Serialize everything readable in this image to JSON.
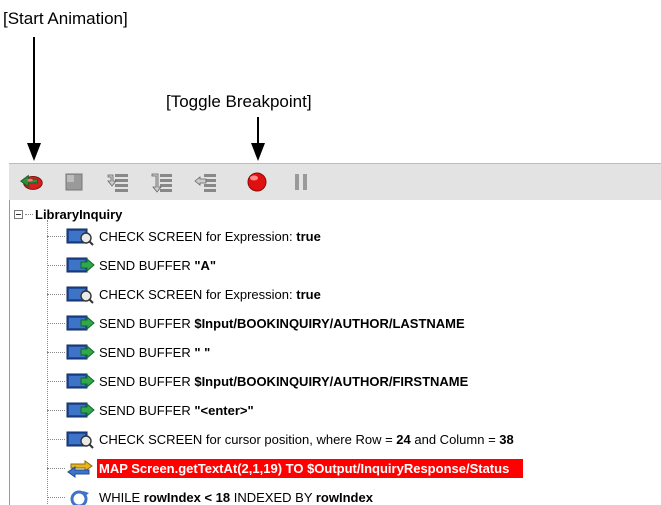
{
  "callouts": {
    "start": "[Start Animation]",
    "toggle": "[Toggle Breakpoint]"
  },
  "toolbar": {
    "buttons": [
      {
        "name": "start-animation-button",
        "icon": "start-animation-icon"
      },
      {
        "name": "stop-button",
        "icon": "stop-icon"
      },
      {
        "name": "step-into-button",
        "icon": "step-into-icon"
      },
      {
        "name": "step-over-button",
        "icon": "step-over-icon"
      },
      {
        "name": "step-out-button",
        "icon": "step-out-icon"
      },
      {
        "name": "toggle-breakpoint-button",
        "icon": "breakpoint-icon"
      },
      {
        "name": "pause-button",
        "icon": "pause-icon"
      }
    ]
  },
  "tree": {
    "root_label": "LibraryInquiry",
    "rows": [
      {
        "icon": "check-screen-icon",
        "text": "CHECK SCREEN for Expression: ",
        "bold": "true"
      },
      {
        "icon": "send-buffer-icon",
        "text": "SEND BUFFER ",
        "bold": "\"A\""
      },
      {
        "icon": "check-screen-icon",
        "text": "CHECK SCREEN for Expression: ",
        "bold": "true"
      },
      {
        "icon": "send-buffer-icon",
        "text": "SEND BUFFER ",
        "bold": "$Input/BOOKINQUIRY/AUTHOR/LASTNAME"
      },
      {
        "icon": "send-buffer-icon",
        "text": "SEND BUFFER ",
        "bold": "\" \""
      },
      {
        "icon": "send-buffer-icon",
        "text": "SEND BUFFER ",
        "bold": "$Input/BOOKINQUIRY/AUTHOR/FIRSTNAME"
      },
      {
        "icon": "send-buffer-icon",
        "text": "SEND BUFFER ",
        "bold": "\"<enter>\""
      },
      {
        "icon": "check-screen-icon",
        "text": "CHECK SCREEN for cursor position, where Row = ",
        "bold": "24",
        "text2": " and Column = ",
        "bold2": "38"
      },
      {
        "icon": "map-icon",
        "text": "MAP Screen.getTextAt(2,1,19) TO $Output/InquiryResponse/Status",
        "selected": true
      },
      {
        "icon": "while-loop-icon",
        "text": "WHILE ",
        "bold": "rowIndex < 18",
        "text2": " INDEXED BY ",
        "bold2": "rowIndex"
      }
    ]
  },
  "colors": {
    "selection": "#ff0000",
    "toolbar_bg": "#e3e3e3",
    "start_icon_red": "#d42020",
    "start_icon_green": "#2f8f3a",
    "breakpoint_red": "#e01010"
  }
}
